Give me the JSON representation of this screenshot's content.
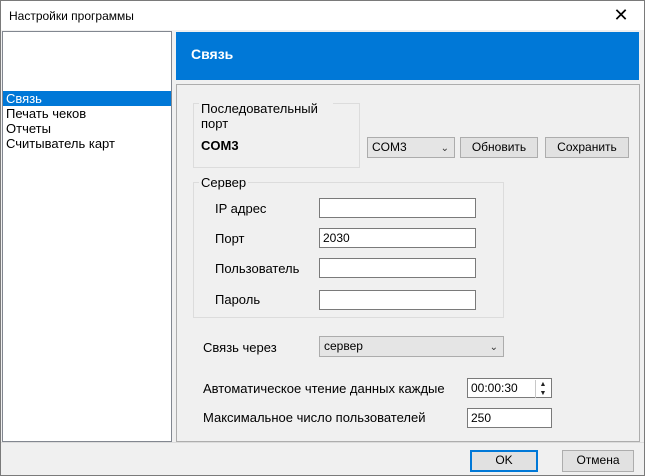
{
  "window": {
    "title": "Настройки программы",
    "close_icon": "close-icon"
  },
  "sidebar": {
    "items": [
      {
        "label": "Связь",
        "selected": true
      },
      {
        "label": "Печать чеков",
        "selected": false
      },
      {
        "label": "Отчеты",
        "selected": false
      },
      {
        "label": "Считыватель карт",
        "selected": false
      }
    ]
  },
  "header": {
    "title": "Связь",
    "color": "#0078d7"
  },
  "serial": {
    "group_label": "Последовательный порт",
    "port_value": "COM3",
    "select_value": "COM3",
    "refresh_label": "Обновить",
    "save_label": "Сохранить"
  },
  "server": {
    "group_label": "Сервер",
    "ip_label": "IP адрес",
    "ip_value": "",
    "port_label": "Порт",
    "port_value": "2030",
    "user_label": "Пользователь",
    "user_value": "",
    "password_label": "Пароль",
    "password_value": ""
  },
  "connection": {
    "label": "Связь через",
    "value": "сервер"
  },
  "auto_read": {
    "label": "Автоматическое чтение данных каждые",
    "value": "00:00:30"
  },
  "max_users": {
    "label": "Максимальное число пользователей",
    "value": "250"
  },
  "footer": {
    "ok_label": "OK",
    "cancel_label": "Отмена"
  }
}
